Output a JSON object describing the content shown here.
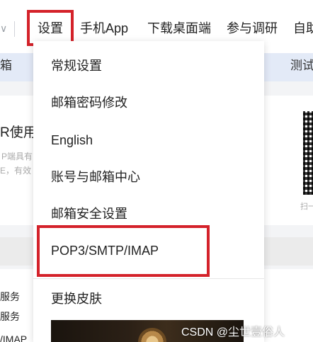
{
  "nav": {
    "chevron": "∨",
    "items": [
      "设置",
      "手机App",
      "下载桌面端",
      "参与调研",
      "自助"
    ]
  },
  "subbar": {
    "left_text": "箱",
    "right_text": "测试"
  },
  "background": {
    "title": "R使用",
    "sub1": "P端具有",
    "sub2": "E，有效",
    "qr_caption": "扫一",
    "service1": "服务",
    "service2": "服务",
    "imap": "/IMAP"
  },
  "dropdown": {
    "items": [
      "常规设置",
      "邮箱密码修改",
      "English",
      "账号与邮箱中心",
      "邮箱安全设置",
      "POP3/SMTP/IMAP",
      "更换皮肤"
    ]
  },
  "watermark": "CSDN @尘世壹俗人",
  "colors": {
    "highlight": "#d4222a",
    "subbar_bg": "#e3eaf7"
  }
}
